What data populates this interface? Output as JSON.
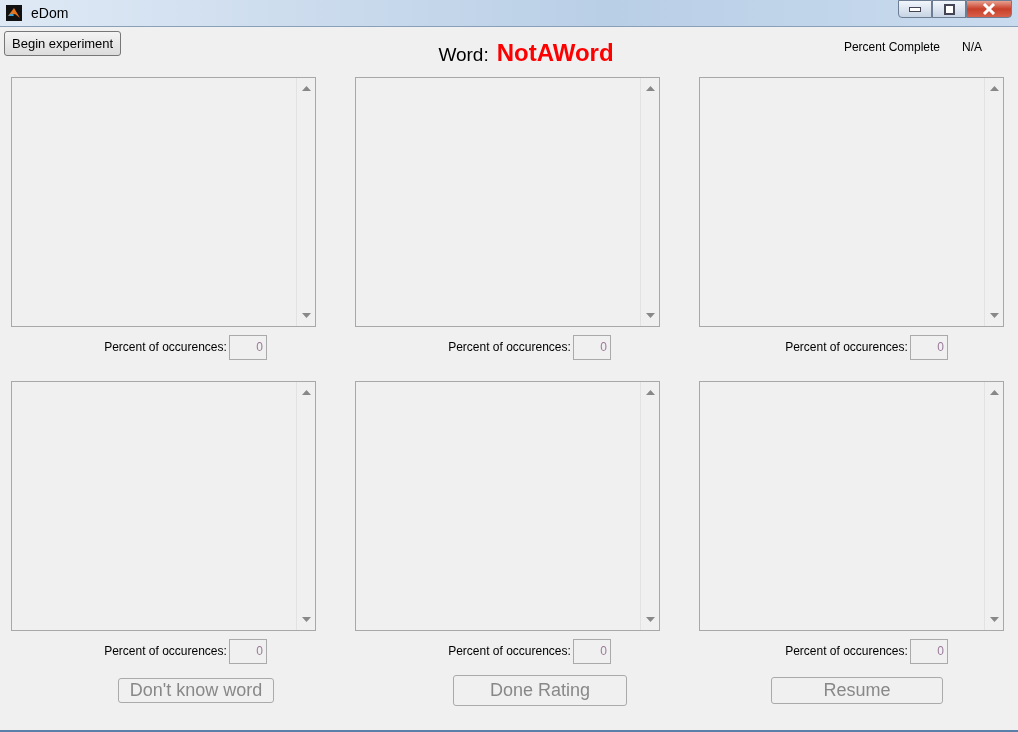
{
  "window": {
    "title": "eDom"
  },
  "begin_button": {
    "label": "Begin experiment",
    "disabled": false
  },
  "word": {
    "label": "Word:",
    "value": "NotAWord"
  },
  "progress": {
    "label": "Percent Complete",
    "value": "N/A"
  },
  "panels": [
    {
      "label": "Percent of occurences:",
      "value": "0"
    },
    {
      "label": "Percent of occurences:",
      "value": "0"
    },
    {
      "label": "Percent of occurences:",
      "value": "0"
    },
    {
      "label": "Percent of occurences:",
      "value": "0"
    },
    {
      "label": "Percent of occurences:",
      "value": "0"
    },
    {
      "label": "Percent of occurences:",
      "value": "0"
    }
  ],
  "buttons": [
    {
      "label": "Don't know word",
      "disabled": true
    },
    {
      "label": "Done Rating",
      "disabled": true
    },
    {
      "label": "Resume",
      "disabled": true
    }
  ]
}
